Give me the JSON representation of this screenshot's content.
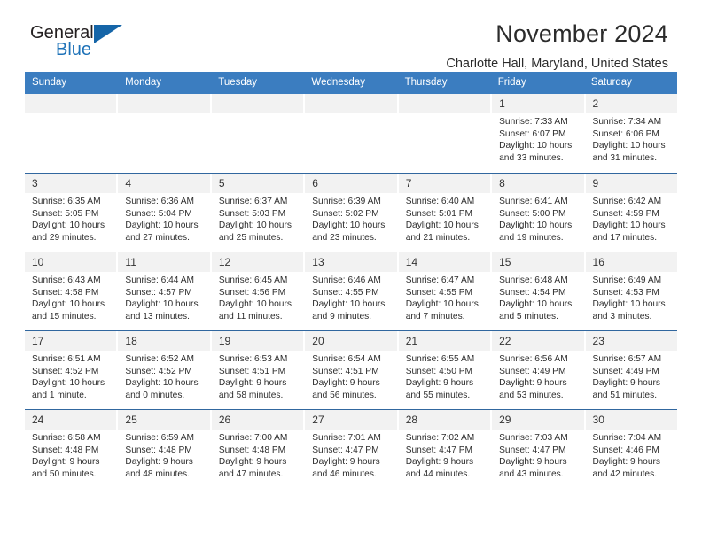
{
  "brand": {
    "name_part1": "General",
    "name_part2": "Blue",
    "triangle_color": "#1565a8"
  },
  "header": {
    "title": "November 2024",
    "subtitle": "Charlotte Hall, Maryland, United States"
  },
  "theme": {
    "header_blue": "#3b7dc0",
    "row_divider_blue": "#31679f",
    "daynum_band": "#f2f2f2"
  },
  "weekdays": [
    "Sunday",
    "Monday",
    "Tuesday",
    "Wednesday",
    "Thursday",
    "Friday",
    "Saturday"
  ],
  "labels": {
    "sunrise": "Sunrise:",
    "sunset": "Sunset:",
    "daylight": "Daylight:"
  },
  "weeks": [
    [
      {
        "day": "",
        "empty": true
      },
      {
        "day": "",
        "empty": true
      },
      {
        "day": "",
        "empty": true
      },
      {
        "day": "",
        "empty": true
      },
      {
        "day": "",
        "empty": true
      },
      {
        "day": "1",
        "sunrise": "Sunrise: 7:33 AM",
        "sunset": "Sunset: 6:07 PM",
        "daylight_l1": "Daylight: 10 hours",
        "daylight_l2": "and 33 minutes."
      },
      {
        "day": "2",
        "sunrise": "Sunrise: 7:34 AM",
        "sunset": "Sunset: 6:06 PM",
        "daylight_l1": "Daylight: 10 hours",
        "daylight_l2": "and 31 minutes."
      }
    ],
    [
      {
        "day": "3",
        "sunrise": "Sunrise: 6:35 AM",
        "sunset": "Sunset: 5:05 PM",
        "daylight_l1": "Daylight: 10 hours",
        "daylight_l2": "and 29 minutes."
      },
      {
        "day": "4",
        "sunrise": "Sunrise: 6:36 AM",
        "sunset": "Sunset: 5:04 PM",
        "daylight_l1": "Daylight: 10 hours",
        "daylight_l2": "and 27 minutes."
      },
      {
        "day": "5",
        "sunrise": "Sunrise: 6:37 AM",
        "sunset": "Sunset: 5:03 PM",
        "daylight_l1": "Daylight: 10 hours",
        "daylight_l2": "and 25 minutes."
      },
      {
        "day": "6",
        "sunrise": "Sunrise: 6:39 AM",
        "sunset": "Sunset: 5:02 PM",
        "daylight_l1": "Daylight: 10 hours",
        "daylight_l2": "and 23 minutes."
      },
      {
        "day": "7",
        "sunrise": "Sunrise: 6:40 AM",
        "sunset": "Sunset: 5:01 PM",
        "daylight_l1": "Daylight: 10 hours",
        "daylight_l2": "and 21 minutes."
      },
      {
        "day": "8",
        "sunrise": "Sunrise: 6:41 AM",
        "sunset": "Sunset: 5:00 PM",
        "daylight_l1": "Daylight: 10 hours",
        "daylight_l2": "and 19 minutes."
      },
      {
        "day": "9",
        "sunrise": "Sunrise: 6:42 AM",
        "sunset": "Sunset: 4:59 PM",
        "daylight_l1": "Daylight: 10 hours",
        "daylight_l2": "and 17 minutes."
      }
    ],
    [
      {
        "day": "10",
        "sunrise": "Sunrise: 6:43 AM",
        "sunset": "Sunset: 4:58 PM",
        "daylight_l1": "Daylight: 10 hours",
        "daylight_l2": "and 15 minutes."
      },
      {
        "day": "11",
        "sunrise": "Sunrise: 6:44 AM",
        "sunset": "Sunset: 4:57 PM",
        "daylight_l1": "Daylight: 10 hours",
        "daylight_l2": "and 13 minutes."
      },
      {
        "day": "12",
        "sunrise": "Sunrise: 6:45 AM",
        "sunset": "Sunset: 4:56 PM",
        "daylight_l1": "Daylight: 10 hours",
        "daylight_l2": "and 11 minutes."
      },
      {
        "day": "13",
        "sunrise": "Sunrise: 6:46 AM",
        "sunset": "Sunset: 4:55 PM",
        "daylight_l1": "Daylight: 10 hours",
        "daylight_l2": "and 9 minutes."
      },
      {
        "day": "14",
        "sunrise": "Sunrise: 6:47 AM",
        "sunset": "Sunset: 4:55 PM",
        "daylight_l1": "Daylight: 10 hours",
        "daylight_l2": "and 7 minutes."
      },
      {
        "day": "15",
        "sunrise": "Sunrise: 6:48 AM",
        "sunset": "Sunset: 4:54 PM",
        "daylight_l1": "Daylight: 10 hours",
        "daylight_l2": "and 5 minutes."
      },
      {
        "day": "16",
        "sunrise": "Sunrise: 6:49 AM",
        "sunset": "Sunset: 4:53 PM",
        "daylight_l1": "Daylight: 10 hours",
        "daylight_l2": "and 3 minutes."
      }
    ],
    [
      {
        "day": "17",
        "sunrise": "Sunrise: 6:51 AM",
        "sunset": "Sunset: 4:52 PM",
        "daylight_l1": "Daylight: 10 hours",
        "daylight_l2": "and 1 minute."
      },
      {
        "day": "18",
        "sunrise": "Sunrise: 6:52 AM",
        "sunset": "Sunset: 4:52 PM",
        "daylight_l1": "Daylight: 10 hours",
        "daylight_l2": "and 0 minutes."
      },
      {
        "day": "19",
        "sunrise": "Sunrise: 6:53 AM",
        "sunset": "Sunset: 4:51 PM",
        "daylight_l1": "Daylight: 9 hours",
        "daylight_l2": "and 58 minutes."
      },
      {
        "day": "20",
        "sunrise": "Sunrise: 6:54 AM",
        "sunset": "Sunset: 4:51 PM",
        "daylight_l1": "Daylight: 9 hours",
        "daylight_l2": "and 56 minutes."
      },
      {
        "day": "21",
        "sunrise": "Sunrise: 6:55 AM",
        "sunset": "Sunset: 4:50 PM",
        "daylight_l1": "Daylight: 9 hours",
        "daylight_l2": "and 55 minutes."
      },
      {
        "day": "22",
        "sunrise": "Sunrise: 6:56 AM",
        "sunset": "Sunset: 4:49 PM",
        "daylight_l1": "Daylight: 9 hours",
        "daylight_l2": "and 53 minutes."
      },
      {
        "day": "23",
        "sunrise": "Sunrise: 6:57 AM",
        "sunset": "Sunset: 4:49 PM",
        "daylight_l1": "Daylight: 9 hours",
        "daylight_l2": "and 51 minutes."
      }
    ],
    [
      {
        "day": "24",
        "sunrise": "Sunrise: 6:58 AM",
        "sunset": "Sunset: 4:48 PM",
        "daylight_l1": "Daylight: 9 hours",
        "daylight_l2": "and 50 minutes."
      },
      {
        "day": "25",
        "sunrise": "Sunrise: 6:59 AM",
        "sunset": "Sunset: 4:48 PM",
        "daylight_l1": "Daylight: 9 hours",
        "daylight_l2": "and 48 minutes."
      },
      {
        "day": "26",
        "sunrise": "Sunrise: 7:00 AM",
        "sunset": "Sunset: 4:48 PM",
        "daylight_l1": "Daylight: 9 hours",
        "daylight_l2": "and 47 minutes."
      },
      {
        "day": "27",
        "sunrise": "Sunrise: 7:01 AM",
        "sunset": "Sunset: 4:47 PM",
        "daylight_l1": "Daylight: 9 hours",
        "daylight_l2": "and 46 minutes."
      },
      {
        "day": "28",
        "sunrise": "Sunrise: 7:02 AM",
        "sunset": "Sunset: 4:47 PM",
        "daylight_l1": "Daylight: 9 hours",
        "daylight_l2": "and 44 minutes."
      },
      {
        "day": "29",
        "sunrise": "Sunrise: 7:03 AM",
        "sunset": "Sunset: 4:47 PM",
        "daylight_l1": "Daylight: 9 hours",
        "daylight_l2": "and 43 minutes."
      },
      {
        "day": "30",
        "sunrise": "Sunrise: 7:04 AM",
        "sunset": "Sunset: 4:46 PM",
        "daylight_l1": "Daylight: 9 hours",
        "daylight_l2": "and 42 minutes."
      }
    ]
  ]
}
